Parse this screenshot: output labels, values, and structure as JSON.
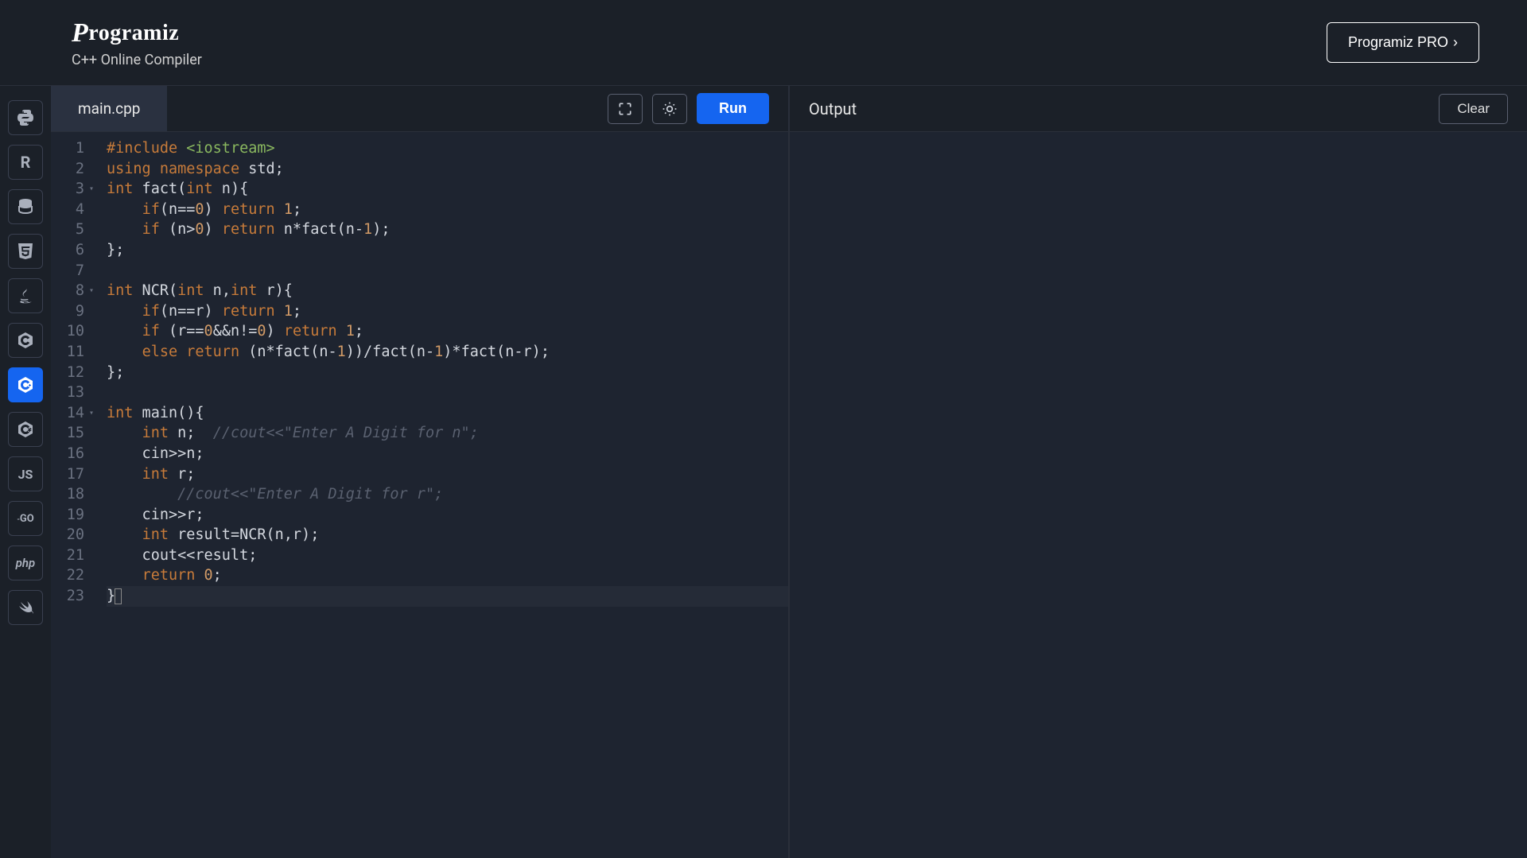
{
  "header": {
    "logo": "Programiz",
    "subtitle": "C++ Online Compiler",
    "pro_label": "Programiz PRO"
  },
  "sidebar": {
    "languages": [
      {
        "id": "python",
        "glyph": "py"
      },
      {
        "id": "r",
        "glyph": "R"
      },
      {
        "id": "sql",
        "glyph": "db"
      },
      {
        "id": "html",
        "glyph": "5"
      },
      {
        "id": "java",
        "glyph": "java"
      },
      {
        "id": "c",
        "glyph": "C"
      },
      {
        "id": "cpp",
        "glyph": "C",
        "active": true
      },
      {
        "id": "csharp",
        "glyph": "C"
      },
      {
        "id": "js",
        "glyph": "JS"
      },
      {
        "id": "go",
        "glyph": "GO"
      },
      {
        "id": "php",
        "glyph": "php"
      },
      {
        "id": "swift",
        "glyph": "swift"
      }
    ]
  },
  "editor": {
    "filename": "main.cpp",
    "run_label": "Run",
    "lines": [
      {
        "n": 1,
        "fold": false
      },
      {
        "n": 2,
        "fold": false
      },
      {
        "n": 3,
        "fold": true
      },
      {
        "n": 4,
        "fold": false
      },
      {
        "n": 5,
        "fold": false
      },
      {
        "n": 6,
        "fold": false
      },
      {
        "n": 7,
        "fold": false
      },
      {
        "n": 8,
        "fold": true
      },
      {
        "n": 9,
        "fold": false
      },
      {
        "n": 10,
        "fold": false
      },
      {
        "n": 11,
        "fold": false
      },
      {
        "n": 12,
        "fold": false
      },
      {
        "n": 13,
        "fold": false
      },
      {
        "n": 14,
        "fold": true
      },
      {
        "n": 15,
        "fold": false
      },
      {
        "n": 16,
        "fold": false
      },
      {
        "n": 17,
        "fold": false
      },
      {
        "n": 18,
        "fold": false
      },
      {
        "n": 19,
        "fold": false
      },
      {
        "n": 20,
        "fold": false
      },
      {
        "n": 21,
        "fold": false
      },
      {
        "n": 22,
        "fold": false
      },
      {
        "n": 23,
        "fold": false
      }
    ],
    "code_tokens": [
      [
        [
          "pre",
          "#include "
        ],
        [
          "str",
          "<iostream>"
        ]
      ],
      [
        [
          "kw",
          "using"
        ],
        [
          "",
          " "
        ],
        [
          "kw",
          "namespace"
        ],
        [
          "",
          " std;"
        ]
      ],
      [
        [
          "type",
          "int"
        ],
        [
          "",
          " fact("
        ],
        [
          "type",
          "int"
        ],
        [
          "",
          " n){"
        ]
      ],
      [
        [
          "",
          "    "
        ],
        [
          "kw",
          "if"
        ],
        [
          "",
          "(n=="
        ],
        [
          "num",
          "0"
        ],
        [
          "",
          ") "
        ],
        [
          "kw",
          "return"
        ],
        [
          "",
          " "
        ],
        [
          "num",
          "1"
        ],
        [
          "",
          ";"
        ]
      ],
      [
        [
          "",
          "    "
        ],
        [
          "kw",
          "if"
        ],
        [
          "",
          " (n>"
        ],
        [
          "num",
          "0"
        ],
        [
          "",
          ") "
        ],
        [
          "kw",
          "return"
        ],
        [
          "",
          " n*fact(n-"
        ],
        [
          "num",
          "1"
        ],
        [
          "",
          ");"
        ]
      ],
      [
        [
          "",
          "};"
        ]
      ],
      [
        [
          "",
          ""
        ]
      ],
      [
        [
          "type",
          "int"
        ],
        [
          "",
          " NCR("
        ],
        [
          "type",
          "int"
        ],
        [
          "",
          " n,"
        ],
        [
          "type",
          "int"
        ],
        [
          "",
          " r){"
        ]
      ],
      [
        [
          "",
          "    "
        ],
        [
          "kw",
          "if"
        ],
        [
          "",
          "(n==r) "
        ],
        [
          "kw",
          "return"
        ],
        [
          "",
          " "
        ],
        [
          "num",
          "1"
        ],
        [
          "",
          ";"
        ]
      ],
      [
        [
          "",
          "    "
        ],
        [
          "kw",
          "if"
        ],
        [
          "",
          " (r=="
        ],
        [
          "num",
          "0"
        ],
        [
          "",
          "&&n!="
        ],
        [
          "num",
          "0"
        ],
        [
          "",
          ") "
        ],
        [
          "kw",
          "return"
        ],
        [
          "",
          " "
        ],
        [
          "num",
          "1"
        ],
        [
          "",
          ";"
        ]
      ],
      [
        [
          "",
          "    "
        ],
        [
          "kw",
          "else"
        ],
        [
          "",
          " "
        ],
        [
          "kw",
          "return"
        ],
        [
          "",
          " (n*fact(n-"
        ],
        [
          "num",
          "1"
        ],
        [
          "",
          "))/fact(n-"
        ],
        [
          "num",
          "1"
        ],
        [
          "",
          ")*fact(n-r);"
        ]
      ],
      [
        [
          "",
          "};"
        ]
      ],
      [
        [
          "",
          ""
        ]
      ],
      [
        [
          "type",
          "int"
        ],
        [
          "",
          " main(){"
        ]
      ],
      [
        [
          "",
          "    "
        ],
        [
          "type",
          "int"
        ],
        [
          "",
          " n;  "
        ],
        [
          "cm",
          "//cout<<\"Enter A Digit for n\";"
        ]
      ],
      [
        [
          "",
          "    cin>>n;"
        ]
      ],
      [
        [
          "",
          "    "
        ],
        [
          "type",
          "int"
        ],
        [
          "",
          " r;"
        ]
      ],
      [
        [
          "",
          "        "
        ],
        [
          "cm",
          "//cout<<\"Enter A Digit for r\";"
        ]
      ],
      [
        [
          "",
          "    cin>>r;"
        ]
      ],
      [
        [
          "",
          "    "
        ],
        [
          "type",
          "int"
        ],
        [
          "",
          " result=NCR(n,r);"
        ]
      ],
      [
        [
          "",
          "    cout<<result;"
        ]
      ],
      [
        [
          "",
          "    "
        ],
        [
          "kw",
          "return"
        ],
        [
          "",
          " "
        ],
        [
          "num",
          "0"
        ],
        [
          "",
          ";"
        ]
      ],
      [
        [
          "",
          "}"
        ]
      ]
    ]
  },
  "output": {
    "title": "Output",
    "clear_label": "Clear"
  }
}
